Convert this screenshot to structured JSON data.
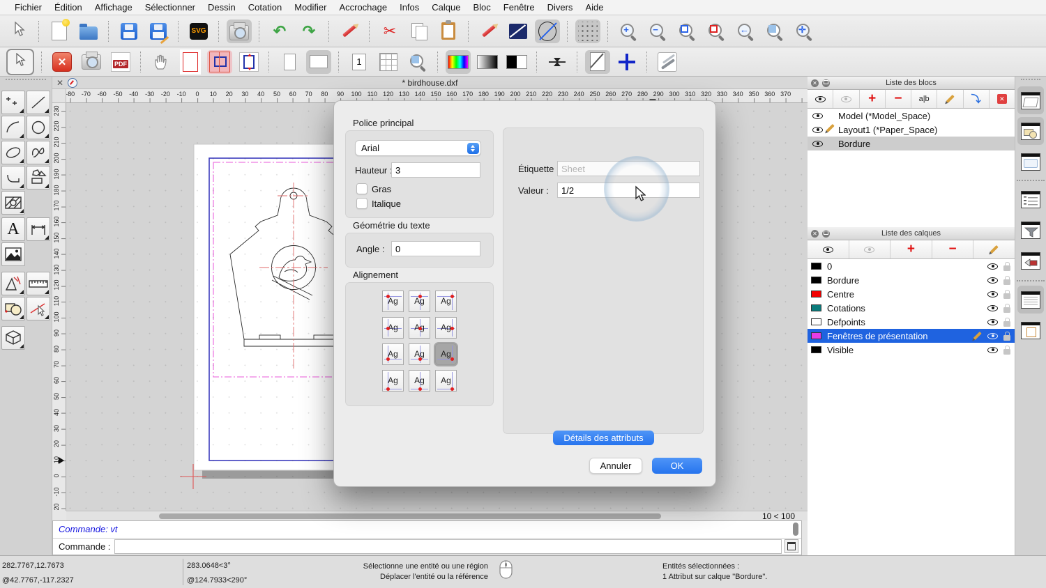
{
  "menu": {
    "items": [
      "Fichier",
      "Édition",
      "Affichage",
      "Sélectionner",
      "Dessin",
      "Cotation",
      "Modifier",
      "Accrochage",
      "Infos",
      "Calque",
      "Bloc",
      "Fenêtre",
      "Divers",
      "Aide"
    ]
  },
  "toolbar": {
    "svg_label": "SVG",
    "pdf_label": "PDF",
    "page_one_label": "1"
  },
  "document": {
    "title": "* birdhouse.dxf",
    "zoom_ratio": "10 < 100"
  },
  "rulers": {
    "h": {
      "start": -80,
      "end": 370,
      "step": 10,
      "origin": 188,
      "scale": 2.28
    },
    "v": {
      "start": -20,
      "end": 230,
      "step": 10,
      "origin": 536,
      "scale": 2.28
    }
  },
  "dialog": {
    "font_group_label": "Police principal",
    "font_name": "Arial",
    "height_label": "Hauteur :",
    "height_value": "3",
    "bold_label": "Gras",
    "italic_label": "Italique",
    "geometry_group_label": "Géométrie du texte",
    "angle_label": "Angle :",
    "angle_value": "0",
    "alignment_label": "Alignement",
    "alignment_sample": "Ag",
    "tag_label": "Étiquette :",
    "tag_placeholder": "Sheet",
    "value_label": "Valeur :",
    "value_value": "1/2",
    "details_button": "Détails des attributs",
    "cancel_button": "Annuler",
    "ok_button": "OK"
  },
  "blocks_panel": {
    "title": "Liste des blocs",
    "rename_tool_label": "a|b",
    "items": [
      {
        "name": "Model (*Model_Space)"
      },
      {
        "name": "Layout1 (*Paper_Space)"
      },
      {
        "name": "Bordure"
      }
    ]
  },
  "layers_panel": {
    "title": "Liste des calques",
    "items": [
      {
        "name": "0",
        "color": "#000000"
      },
      {
        "name": "Bordure",
        "color": "#000000"
      },
      {
        "name": "Centre",
        "color": "#f20000"
      },
      {
        "name": "Cotations",
        "color": "#0b7c7c"
      },
      {
        "name": "Defpoints",
        "color": "#ffffff"
      },
      {
        "name": "Fenêtres de présentation",
        "color": "#e63ce6"
      },
      {
        "name": "Visible",
        "color": "#000000"
      }
    ]
  },
  "console": {
    "history": "Commande: vt",
    "prompt": "Commande :"
  },
  "status": {
    "abs_coord": "282.7767,12.7673",
    "rel_coord": "@42.7767,-117.2327",
    "abs_polar": "283.0648<3°",
    "rel_polar": "@124.7933<290°",
    "hint_line1": "Sélectionne une entité ou une région",
    "hint_line2": "Déplacer l'entité ou la référence",
    "selection_line1": "Entités sélectionnées :",
    "selection_line2": "1 Attribut sur calque \"Bordure\"."
  }
}
